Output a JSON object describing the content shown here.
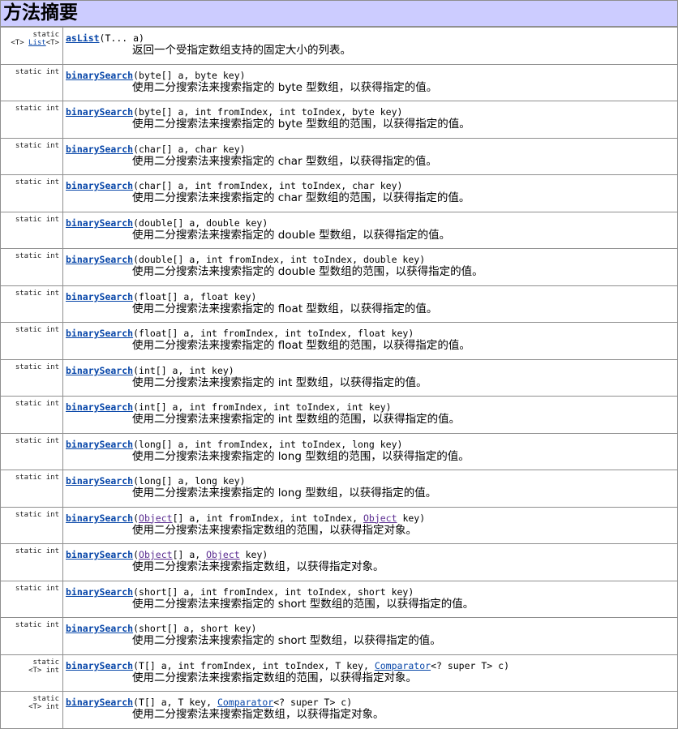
{
  "header": {
    "title": "方法摘要"
  },
  "colors": {
    "header_bg": "#ccccff",
    "link": "#0645a8",
    "visited_link": "#5b2d91",
    "border": "#8f8f8f"
  },
  "rows": [
    {
      "type": [
        "static",
        "<T> |List|<T>"
      ],
      "name": "asList",
      "params": "(T... a)",
      "desc": "返回一个受指定数组支持的固定大小的列表。"
    },
    {
      "type": [
        "static int"
      ],
      "name": "binarySearch",
      "params": "(byte[] a, byte key)",
      "desc": "使用二分搜索法来搜索指定的 byte 型数组，以获得指定的值。"
    },
    {
      "type": [
        "static int"
      ],
      "name": "binarySearch",
      "params": "(byte[] a, int fromIndex, int toIndex, byte key)",
      "desc": "使用二分搜索法来搜索指定的 byte 型数组的范围，以获得指定的值。"
    },
    {
      "type": [
        "static int"
      ],
      "name": "binarySearch",
      "params": "(char[] a, char key)",
      "desc": "使用二分搜索法来搜索指定的 char 型数组，以获得指定的值。"
    },
    {
      "type": [
        "static int"
      ],
      "name": "binarySearch",
      "params": "(char[] a, int fromIndex, int toIndex, char key)",
      "desc": "使用二分搜索法来搜索指定的 char 型数组的范围，以获得指定的值。"
    },
    {
      "type": [
        "static int"
      ],
      "name": "binarySearch",
      "params": "(double[] a, double key)",
      "desc": "使用二分搜索法来搜索指定的 double 型数组，以获得指定的值。"
    },
    {
      "type": [
        "static int"
      ],
      "name": "binarySearch",
      "params": "(double[] a, int fromIndex, int toIndex, double key)",
      "desc": "使用二分搜索法来搜索指定的 double 型数组的范围，以获得指定的值。"
    },
    {
      "type": [
        "static int"
      ],
      "name": "binarySearch",
      "params": "(float[] a, float key)",
      "desc": "使用二分搜索法来搜索指定的 float 型数组，以获得指定的值。"
    },
    {
      "type": [
        "static int"
      ],
      "name": "binarySearch",
      "params": "(float[] a, int fromIndex, int toIndex, float key)",
      "desc": "使用二分搜索法来搜索指定的 float 型数组的范围，以获得指定的值。"
    },
    {
      "type": [
        "static int"
      ],
      "name": "binarySearch",
      "params": "(int[] a, int key)",
      "desc": "使用二分搜索法来搜索指定的 int 型数组，以获得指定的值。"
    },
    {
      "type": [
        "static int"
      ],
      "name": "binarySearch",
      "params": "(int[] a, int fromIndex, int toIndex, int key)",
      "desc": "使用二分搜索法来搜索指定的 int 型数组的范围，以获得指定的值。"
    },
    {
      "type": [
        "static int"
      ],
      "name": "binarySearch",
      "params": "(long[] a, int fromIndex, int toIndex, long key)",
      "desc": "使用二分搜索法来搜索指定的 long 型数组的范围，以获得指定的值。"
    },
    {
      "type": [
        "static int"
      ],
      "name": "binarySearch",
      "params": "(long[] a, long key)",
      "desc": "使用二分搜索法来搜索指定的 long 型数组，以获得指定的值。"
    },
    {
      "type": [
        "static int"
      ],
      "name": "binarySearch",
      "params": "(|Object|[] a, int fromIndex, int toIndex, |Object| key)",
      "desc": "使用二分搜索法来搜索指定数组的范围，以获得指定对象。"
    },
    {
      "type": [
        "static int"
      ],
      "name": "binarySearch",
      "params": "(|Object|[] a, |Object| key)",
      "desc": "使用二分搜索法来搜索指定数组，以获得指定对象。"
    },
    {
      "type": [
        "static int"
      ],
      "name": "binarySearch",
      "params": "(short[] a, int fromIndex, int toIndex, short key)",
      "desc": "使用二分搜索法来搜索指定的 short 型数组的范围，以获得指定的值。"
    },
    {
      "type": [
        "static int"
      ],
      "name": "binarySearch",
      "params": "(short[] a, short key)",
      "desc": "使用二分搜索法来搜索指定的 short 型数组，以获得指定的值。"
    },
    {
      "type": [
        "static",
        "<T> int"
      ],
      "name": "binarySearch",
      "params": "(T[] a, int fromIndex, int toIndex, T key, ~Comparator~<? super T> c)",
      "desc": "使用二分搜索法来搜索指定数组的范围，以获得指定对象。"
    },
    {
      "type": [
        "static",
        "<T> int"
      ],
      "name": "binarySearch",
      "params": "(T[] a, T key, ~Comparator~<? super T> c)",
      "desc": "使用二分搜索法来搜索指定数组，以获得指定对象。"
    }
  ]
}
